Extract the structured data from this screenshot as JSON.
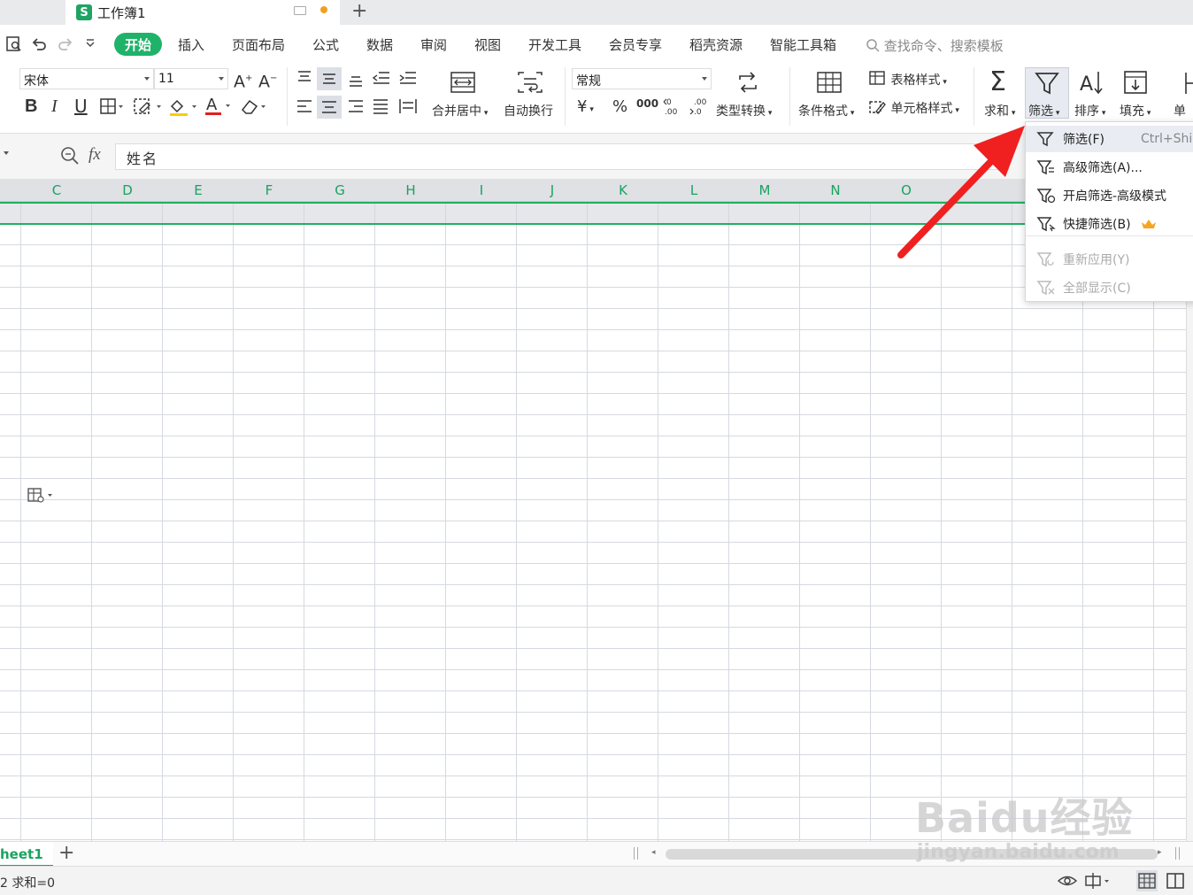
{
  "titlebar": {
    "doc_title": "工作簿1",
    "logo_letter": "S",
    "add_tab": "+"
  },
  "menu": {
    "start": "开始",
    "items": [
      "插入",
      "页面布局",
      "公式",
      "数据",
      "审阅",
      "视图",
      "开发工具",
      "会员专享",
      "稻壳资源",
      "智能工具箱"
    ],
    "search_placeholder": "查找命令、搜索模板"
  },
  "ribbon": {
    "font_name": "宋体",
    "font_size": "11",
    "number_format": "常规",
    "merge_label": "合并居中",
    "wrap_label": "自动换行",
    "convert_label": "类型转换",
    "cond_format_label": "条件格式",
    "table_style_label": "表格样式",
    "cell_style_label": "单元格样式",
    "sum_label": "求和",
    "filter_label": "筛选",
    "sort_label": "排序",
    "fill_label": "填充",
    "cell_label": "单元",
    "currency": "¥",
    "percent": "%",
    "thousands": "000"
  },
  "formula": {
    "fx": "fx",
    "value": "姓名"
  },
  "columns": [
    "C",
    "D",
    "E",
    "F",
    "G",
    "H",
    "I",
    "J",
    "K",
    "L",
    "M",
    "N",
    "O"
  ],
  "dropdown": {
    "items": [
      {
        "label": "筛选(F)",
        "shortcut": "Ctrl+Shi",
        "disabled": false,
        "highlight": true
      },
      {
        "label": "高级筛选(A)...",
        "shortcut": "",
        "disabled": false,
        "highlight": false
      },
      {
        "label": "开启筛选-高级模式",
        "shortcut": "",
        "disabled": false,
        "highlight": false
      },
      {
        "label": "快捷筛选(B)",
        "shortcut": "",
        "disabled": false,
        "highlight": false
      },
      {
        "label": "重新应用(Y)",
        "shortcut": "",
        "disabled": true,
        "highlight": false
      },
      {
        "label": "全部显示(C)",
        "shortcut": "",
        "disabled": true,
        "highlight": false
      }
    ]
  },
  "sheetbar": {
    "sheet_name": "heet1",
    "add": "+"
  },
  "statusbar": {
    "left_text": "2 求和=0"
  },
  "watermark": {
    "main": "Baidu经验",
    "sub": "jingyan.baidu.com"
  },
  "colors": {
    "accent": "#1fb36a",
    "arrow": "#f02020",
    "crown": "#f5a623"
  }
}
